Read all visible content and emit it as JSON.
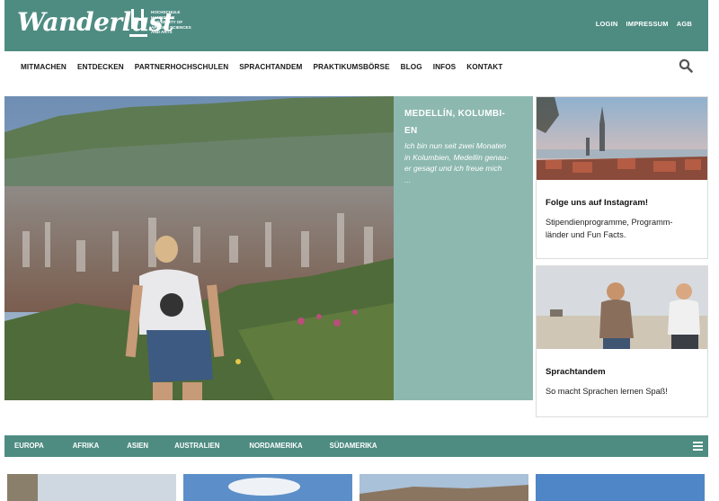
{
  "header": {
    "logo_text": "Wanderlust",
    "partner_logo_lines": [
      "Hochschule",
      "Hannover",
      "University of",
      "Applied Sciences",
      "and Arts"
    ],
    "top_links": [
      "LOGIN",
      "IMPRESSUM",
      "AGB"
    ],
    "brand_color": "#4e8c82"
  },
  "nav": {
    "items": [
      "MITMACHEN",
      "ENTDECKEN",
      "PARTNERHOCHSCHULEN",
      "SPRACHTANDEM",
      "PRAKTIKUMSBÖRSE",
      "BLOG",
      "INFOS",
      "KONTAKT"
    ],
    "search_icon": "search-icon"
  },
  "hero": {
    "title_line1": "MEDELLÍN, KOLUMBI-",
    "title_line2": "EN",
    "excerpt_lines": [
      "Ich bin nun seit zwei Monaten",
      "in Kolumbien, Medellín genau-",
      "er gesagt und ich freue mich",
      "..."
    ],
    "panel_color": "#8cb8af"
  },
  "cards": [
    {
      "title": "Folge uns auf Instagram!",
      "text_lines": [
        "Stipendienprogramme, Programm-",
        "länder und Fun Facts."
      ]
    },
    {
      "title": "Sprachtandem",
      "text_lines": [
        "So macht Sprachen lernen Spaß!"
      ]
    }
  ],
  "continents": {
    "items": [
      "EUROPA",
      "AFRIKA",
      "ASIEN",
      "AUSTRALIEN",
      "NORDAMERIKA",
      "SÜDAMERIKA"
    ],
    "menu_icon": "hamburger-menu-icon"
  }
}
